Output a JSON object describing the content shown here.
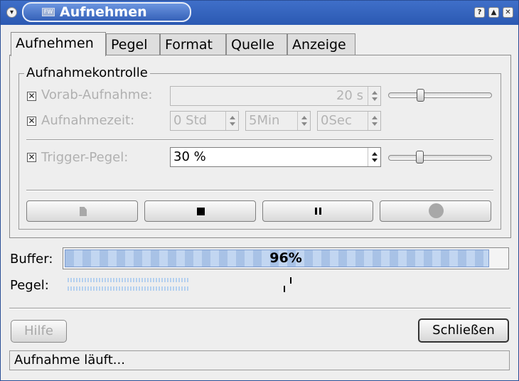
{
  "window": {
    "title": "Aufnehmen",
    "title_icon": "window-app-icon",
    "title_icon_text": "FW"
  },
  "tabs": [
    {
      "label": "Aufnehmen",
      "active": true
    },
    {
      "label": "Pegel",
      "active": false
    },
    {
      "label": "Format",
      "active": false
    },
    {
      "label": "Quelle",
      "active": false
    },
    {
      "label": "Anzeige",
      "active": false
    }
  ],
  "group": {
    "title": "Aufnahmekontrolle",
    "prerecord": {
      "label": "Vorab-Aufnahme:",
      "value": "20 s",
      "checked": true,
      "enabled": false,
      "slider": 0.3
    },
    "rectime": {
      "label": "Aufnahmezeit:",
      "hours": "0 Std",
      "minutes": "5Min",
      "seconds": "0Sec",
      "checked": true,
      "enabled": false
    },
    "trigger": {
      "label": "Trigger-Pegel:",
      "value": "30 %",
      "checked": true,
      "enabled": true,
      "slider": 0.3
    }
  },
  "controls": {
    "new_icon": "new-file-icon",
    "stop_icon": "stop-icon",
    "pause_icon": "pause-icon",
    "record_icon": "record-icon"
  },
  "buffer": {
    "label": "Buffer:",
    "text": "96%",
    "percent": 96
  },
  "level": {
    "label": "Pegel:"
  },
  "buttons": {
    "help": "Hilfe",
    "close": "Schließen"
  },
  "status": "Aufnahme läuft...",
  "colors": {
    "titlebar": "#2b59b2",
    "progress": "#a8c2e6",
    "window_bg": "#eeeeee"
  }
}
